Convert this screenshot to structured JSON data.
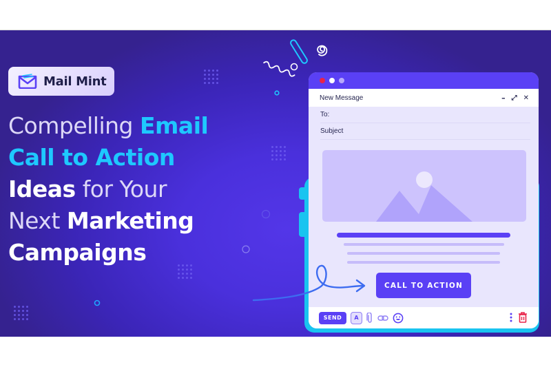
{
  "brand": {
    "name": "Mail Mint",
    "colors": {
      "primary": "#5a40f5",
      "cyan": "#1ec8ff",
      "background": "#3b25b8"
    }
  },
  "headline": {
    "line1": {
      "light": "Compelling ",
      "accent": "Email"
    },
    "line2": {
      "accent": "Call to Action"
    },
    "line3": {
      "bold": "Ideas",
      "light": " for Your"
    },
    "line4": {
      "light": "Next ",
      "bold": "Marketing"
    },
    "line5": {
      "bold": "Campaigns"
    }
  },
  "email_window": {
    "title": "New Message",
    "controls": {
      "minimize": "–",
      "expand": "⤢",
      "close": "✕"
    },
    "fields": [
      {
        "label": "To:"
      },
      {
        "label": "Subject"
      }
    ],
    "cta_label": "CALL TO ACTION",
    "footer": {
      "send_label": "SEND",
      "format_label": "A",
      "icons": [
        "paperclip-icon",
        "link-icon",
        "emoji-icon",
        "more-vertical-icon",
        "trash-icon"
      ]
    },
    "window_dots": [
      "#e8244a",
      "#ffffff",
      "#b7a8fb"
    ]
  }
}
